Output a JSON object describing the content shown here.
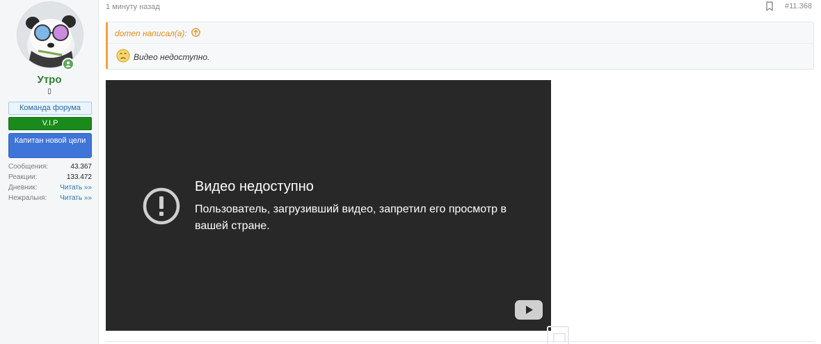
{
  "post": {
    "time": "1 минуту назад",
    "number": "#11.368",
    "bookmark_icon": "bookmark-icon"
  },
  "author": {
    "name": "Утро",
    "small_glyph": "▯",
    "badges": {
      "team": "Команда форума",
      "vip": "V.I.P",
      "captain": "Капитан новой цели"
    },
    "stats": [
      {
        "label": "Сообщения:",
        "value": "43.367",
        "is_link": false
      },
      {
        "label": "Реакции:",
        "value": "133.472",
        "is_link": false
      },
      {
        "label": "Дневник:",
        "value": "Читать »»",
        "is_link": true
      },
      {
        "label": "Нежральня:",
        "value": "Читать »»",
        "is_link": true
      }
    ],
    "online_color": "#5fa85f",
    "name_color": "#2e7d32"
  },
  "quote": {
    "author_text": "domen написал(а):",
    "body": "Видео недоступно.",
    "accent_color": "#f1a33a"
  },
  "video": {
    "title": "Видео недоступно",
    "description": "Пользователь, загрузивший видео, запретил его просмотр в вашей стране.",
    "background": "#282828"
  }
}
